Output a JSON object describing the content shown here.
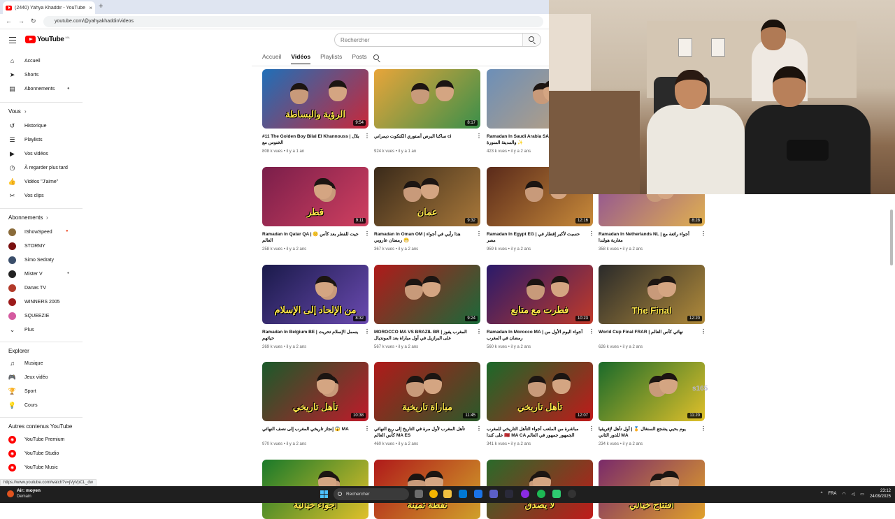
{
  "browser": {
    "tab_title": "(2440) Yahya Khaddir - YouTube",
    "tab_close": "×",
    "new_tab": "+",
    "back": "←",
    "forward": "→",
    "reload": "↻",
    "url": "youtube.com/@yahyakhaddir/videos"
  },
  "header": {
    "logo_text": "YouTube",
    "logo_country": "MA",
    "search_placeholder": "Rechercher"
  },
  "sidebar": {
    "main": [
      {
        "label": "Accueil",
        "icon": "home-icon",
        "glyph": "⌂"
      },
      {
        "label": "Shorts",
        "icon": "shorts-icon",
        "glyph": "➤"
      },
      {
        "label": "Abonnements",
        "icon": "subscriptions-icon",
        "glyph": "▤"
      }
    ],
    "you_title": "Vous",
    "you": [
      {
        "label": "Historique",
        "icon": "history-icon",
        "glyph": "↺"
      },
      {
        "label": "Playlists",
        "icon": "playlists-icon",
        "glyph": "☰"
      },
      {
        "label": "Vos vidéos",
        "icon": "your-videos-icon",
        "glyph": "▶"
      },
      {
        "label": "À regarder plus tard",
        "icon": "watch-later-icon",
        "glyph": "◷"
      },
      {
        "label": "Vidéos \"J'aime\"",
        "icon": "liked-icon",
        "glyph": "👍"
      },
      {
        "label": "Vos clips",
        "icon": "clips-icon",
        "glyph": "✂"
      }
    ],
    "subs_title": "Abonnements",
    "subs": [
      {
        "label": "IShowSpeed",
        "color": "#8a6b3a"
      },
      {
        "label": "STORMY",
        "color": "#7a1010"
      },
      {
        "label": "Simo Sedraty",
        "color": "#3a4e6a"
      },
      {
        "label": "Mister V",
        "color": "#222222"
      },
      {
        "label": "Danas TV",
        "color": "#b23a2a"
      },
      {
        "label": "WINNERS 2005",
        "color": "#9c1a1a"
      },
      {
        "label": "SQUEEZIE",
        "color": "#d45aa0"
      }
    ],
    "more_label": "Plus",
    "explore_title": "Explorer",
    "explore": [
      {
        "label": "Musique",
        "icon": "music-icon",
        "glyph": "♫"
      },
      {
        "label": "Jeux vidéo",
        "icon": "gaming-icon",
        "glyph": "🎮"
      },
      {
        "label": "Sport",
        "icon": "sport-icon",
        "glyph": "🏆"
      },
      {
        "label": "Cours",
        "icon": "courses-icon",
        "glyph": "💡"
      }
    ],
    "other_title": "Autres contenus YouTube",
    "other": [
      {
        "label": "YouTube Premium"
      },
      {
        "label": "YouTube Studio"
      },
      {
        "label": "YouTube Music"
      }
    ]
  },
  "channel_tabs": [
    "Accueil",
    "Vidéos",
    "Playlists",
    "Posts"
  ],
  "videos": [
    {
      "title": "#11 The Golden Boy Bilal El Khannouss | بلال الخنوس مع",
      "views": "808 k vues",
      "age": "il y a 1 an",
      "duration": "9:54",
      "caption": "الرؤية والبساطة",
      "bg1": "#1f6fb8",
      "bg2": "#c8283a"
    },
    {
      "title": "ساكنا البرص أستوري الكنكوت ديمراني ci",
      "views": "924 k vues",
      "age": "il y a 1 an",
      "duration": "8:17",
      "caption": "",
      "bg1": "#e8a53a",
      "bg2": "#3a8f4a"
    },
    {
      "title": "Ramadan In Saudi Arabia SA مكة المكرمة والمدينة المنورة ✨",
      "views": "423 k vues",
      "age": "il y a 2 ans",
      "duration": "",
      "caption": "",
      "bg1": "#6c8fb8",
      "bg2": "#c4a27a"
    },
    {
      "title": "Ramadan In Qatar QA | 🤫 جيت للفطر بعد كأس العالم",
      "views": "258 k vues",
      "age": "il y a 2 ans",
      "duration": "9:11",
      "caption": "قطر",
      "bg1": "#7a1e4a",
      "bg2": "#d04060"
    },
    {
      "title": "Ramadan In Oman OM | هذا رأيي في أجواء رمضان عاروبي 😁",
      "views": "367 k vues",
      "age": "il y a 2 ans",
      "duration": "9:32",
      "caption": "عمان",
      "bg1": "#3a2a1a",
      "bg2": "#a8783a"
    },
    {
      "title": "Ramadan In Egypt EG | حسبت لأكبر إفطار في مصر",
      "views": "959 k vues",
      "age": "il y a 2 ans",
      "duration": "12:16",
      "caption": "",
      "bg1": "#5a2a1a",
      "bg2": "#c88a3a"
    },
    {
      "title": "Ramadan In Netherlands NL | أجواء رائعة مع مغاربة هولندا",
      "views": "358 k vues",
      "age": "il y a 2 ans",
      "duration": "8:28",
      "caption": "",
      "bg1": "#8a4a9a",
      "bg2": "#e0b050"
    },
    {
      "title": "Ramadan In Belgium BE | يسمل الإسلام تحريت حياتهم",
      "views": "269 k vues",
      "age": "il y a 2 ans",
      "duration": "8:32",
      "caption": "من الإلحاد إلى الإسلام",
      "bg1": "#1a1a4a",
      "bg2": "#6a4ab0"
    },
    {
      "title": "MOROCCO MA VS BRAZIL BR | المغرب يفوز على البرازيل في أول مباراة بعد المونديال",
      "views": "567 k vues",
      "age": "il y a 2 ans",
      "duration": "9:24",
      "caption": "",
      "bg1": "#b01a1a",
      "bg2": "#1a6a3a"
    },
    {
      "title": "Ramadan In Morocco MA | أجواء اليوم الأول من رمضان في المغرب",
      "views": "560 k vues",
      "age": "il y a 2 ans",
      "duration": "10:23",
      "caption": "فطرت مع متابع",
      "bg1": "#2a1a6a",
      "bg2": "#c03a2a"
    },
    {
      "title": "World Cup Final FRAR | نهائي كأس العالم",
      "views": "626 k vues",
      "age": "il y a 2 ans",
      "duration": "12:20",
      "caption": "The Final",
      "bg1": "#2a2a2a",
      "bg2": "#b08a3a"
    },
    {
      "title": "إنجاز تاريخي المغرب إلى نصف النهائي 😱 MA",
      "views": "970 k vues",
      "age": "il y a 2 ans",
      "duration": "10:38",
      "caption": "تأهل تاريخي",
      "bg1": "#1a5a2a",
      "bg2": "#c01a2a"
    },
    {
      "title": "تأهل المغرب لأول مرة في التاريخ إلى ربع النهائي كأس العالم MA ES",
      "views": "460 k vues",
      "age": "il y a 2 ans",
      "duration": "11:45",
      "caption": "مباراة تاريخية",
      "bg1": "#b01a1a",
      "bg2": "#2a5a2a"
    },
    {
      "title": "مباشرة من الملعب أجواء التأهل التاريخي للمغرب على كندا 🇲🇦 MA CA الجمهور جمهور في العالم",
      "views": "341 k vues",
      "age": "il y a 2 ans",
      "duration": "12:07",
      "caption": "تأهل تاريخي",
      "bg1": "#1a6a2a",
      "bg2": "#c01a1a"
    },
    {
      "title": "يوم بحيي يشجع السنغال 🏅 | أول تأهل لإفريقيا للدور الثاني MA",
      "views": "234 k vues",
      "age": "il y a 2 ans",
      "duration": "11:20",
      "caption": "",
      "bg1": "#1a6a2a",
      "bg2": "#e0c02a"
    },
    {
      "title": "",
      "views": "",
      "age": "",
      "duration": "",
      "caption": "أجواء خيالية",
      "bg1": "#1a7a2a",
      "bg2": "#e0c02a"
    },
    {
      "title": "",
      "views": "",
      "age": "",
      "duration": "",
      "caption": "نقطة ثمينة",
      "bg1": "#b01a1a",
      "bg2": "#d0a02a"
    },
    {
      "title": "",
      "views": "",
      "age": "",
      "duration": "",
      "caption": "لا يصدق",
      "bg1": "#2a6a2a",
      "bg2": "#c01a1a"
    },
    {
      "title": "",
      "views": "",
      "age": "",
      "duration": "",
      "caption": "افتتاح خيالي",
      "bg1": "#7a2a6a",
      "bg2": "#e0a02a"
    }
  ],
  "overlay_text": "s165",
  "status_link": "https://www.youtube.com/watch?v=jVyVpCL_dw",
  "taskbar": {
    "weather_title": "Air: moyen",
    "weather_sub": "Demain",
    "search": "Rechercher",
    "lang": "FRA",
    "time": "23:12",
    "date": "24/09/2025"
  }
}
